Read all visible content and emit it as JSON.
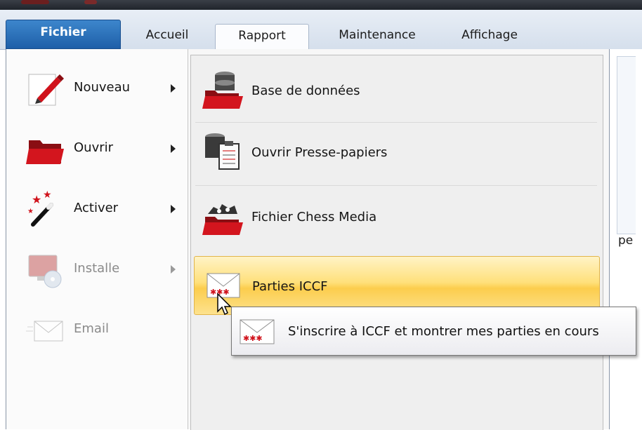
{
  "ribbon": {
    "tabs": [
      {
        "label": "Fichier"
      },
      {
        "label": "Accueil"
      },
      {
        "label": "Rapport"
      },
      {
        "label": "Maintenance"
      },
      {
        "label": "Affichage"
      }
    ],
    "selected_tab": "Rapport"
  },
  "menu": {
    "left_items": [
      {
        "label": "Nouveau",
        "icon": "pen-icon",
        "has_submenu": true,
        "enabled": true
      },
      {
        "label": "Ouvrir",
        "icon": "folder-icon",
        "has_submenu": true,
        "enabled": true
      },
      {
        "label": "Activer",
        "icon": "magic-wand-icon",
        "has_submenu": true,
        "enabled": true
      },
      {
        "label": "Installe",
        "icon": "install-cd-icon",
        "has_submenu": true,
        "enabled": false
      },
      {
        "label": "Email",
        "icon": "email-icon",
        "has_submenu": false,
        "enabled": false
      }
    ],
    "submenu_items": [
      {
        "label": "Base de données",
        "icon": "database-folder-icon"
      },
      {
        "label": "Ouvrir Presse-papiers",
        "icon": "clipboard-database-icon"
      },
      {
        "label": "Fichier Chess Media",
        "icon": "chess-media-folder-icon"
      },
      {
        "label": "Parties ICCF",
        "icon": "iccf-envelope-icon",
        "highlighted": true
      }
    ]
  },
  "tooltip": {
    "text": "S'inscrire à ICCF et montrer mes parties en cours",
    "icon": "iccf-envelope-icon"
  },
  "background": {
    "peek_text": "pe"
  },
  "colors": {
    "file_tab": "#2a6fb8",
    "highlight": "#fcd15a",
    "folder_red": "#c8161d"
  }
}
